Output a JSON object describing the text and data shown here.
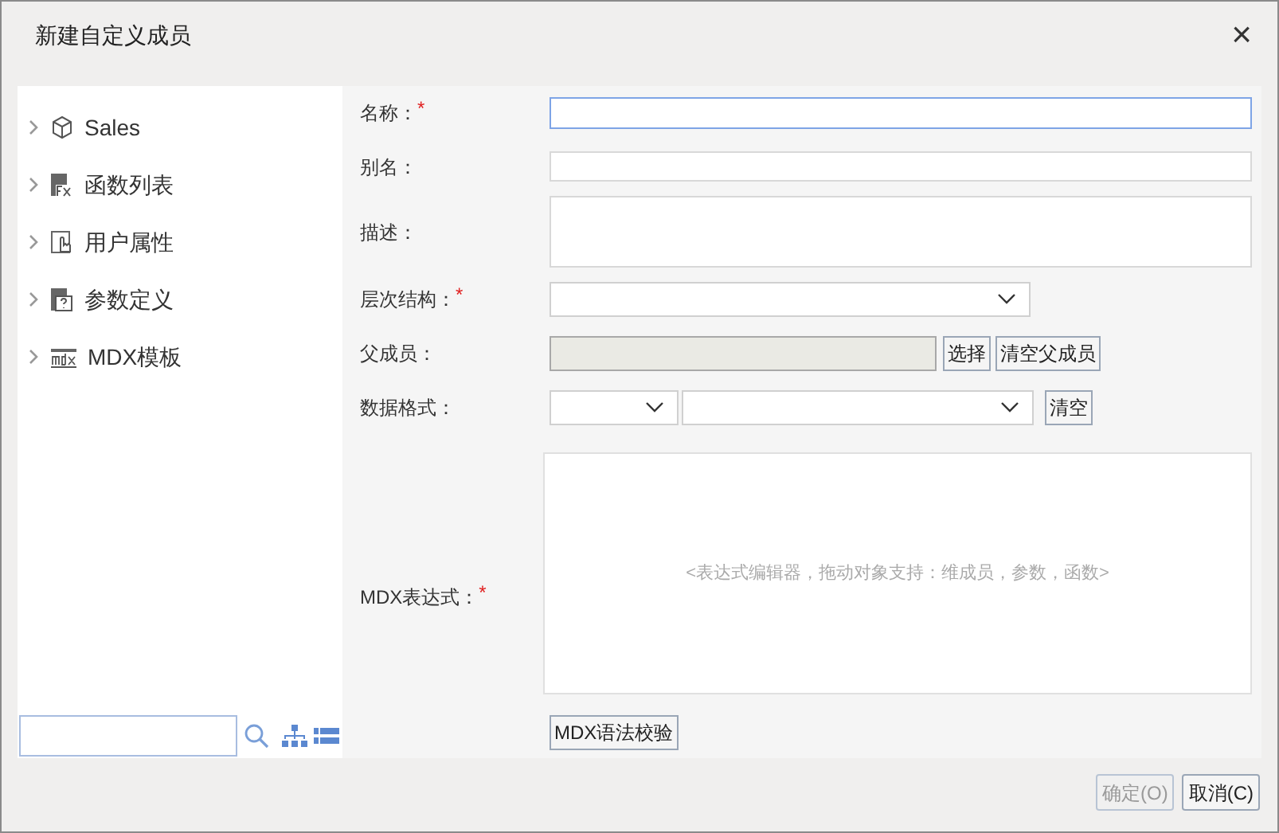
{
  "window": {
    "title": "新建自定义成员",
    "close": "×"
  },
  "tree": [
    {
      "label": "Sales",
      "kind": "cube",
      "expanded": false
    },
    {
      "label": "函数列表",
      "kind": "function",
      "expanded": false
    },
    {
      "label": "用户属性",
      "kind": "hand",
      "expanded": false
    },
    {
      "label": "参数定义",
      "kind": "param",
      "expanded": false
    },
    {
      "label": "MDX模板",
      "kind": "mdx",
      "expanded": false
    }
  ],
  "form": {
    "name": {
      "label": "名称：",
      "required_mark": "*",
      "focused": true
    },
    "alias": {
      "label": "别名："
    },
    "description": {
      "label": "描述："
    },
    "hierarchy": {
      "label": "层次结构：",
      "required_mark": "*"
    },
    "parent": {
      "label": "父成员：",
      "buttons": [
        "选择",
        "清空父成员"
      ]
    },
    "format": {
      "label": "数据格式：",
      "button": "清空"
    },
    "expression": {
      "label": "MDX表达式：",
      "required_mark": "*",
      "placeholder": "<表达式编辑器，拖动对象支持：维成员，参数，函数>"
    },
    "validate": "MDX语法校验"
  },
  "footer": [
    {
      "label": "确定(O)",
      "disabled": true
    },
    {
      "label": "取消(C)",
      "disabled": false
    }
  ]
}
